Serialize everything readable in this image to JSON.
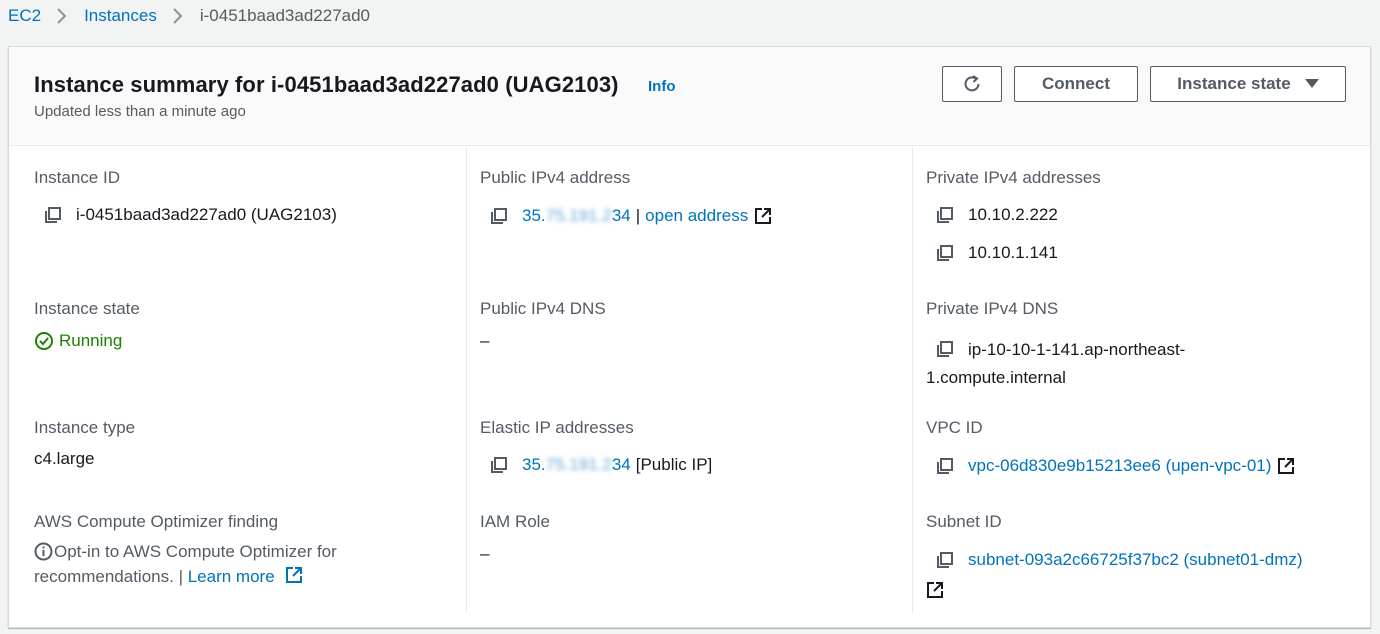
{
  "breadcrumb": {
    "items": [
      "EC2",
      "Instances"
    ],
    "current": "i-0451baad3ad227ad0"
  },
  "header": {
    "title": "Instance summary for i-0451baad3ad227ad0 (UAG2103)",
    "info": "Info",
    "subtitle": "Updated less than a minute ago",
    "connect_label": "Connect",
    "instance_state_label": "Instance state"
  },
  "details": {
    "instance_id": {
      "label": "Instance ID",
      "value": "i-0451baad3ad227ad0 (UAG2103)"
    },
    "public_ipv4": {
      "label": "Public IPv4 address",
      "ip_prefix": "35.",
      "ip_masked": "75.191.2",
      "ip_suffix": "34",
      "separator": "|",
      "open_link": "open address"
    },
    "private_ipv4": {
      "label": "Private IPv4 addresses",
      "values": [
        "10.10.2.222",
        "10.10.1.141"
      ]
    },
    "instance_state": {
      "label": "Instance state",
      "value": "Running"
    },
    "public_dns": {
      "label": "Public IPv4 DNS",
      "value": "–"
    },
    "private_dns": {
      "label": "Private IPv4 DNS",
      "line1": "ip-10-10-1-141.ap-northeast-",
      "line2": "1.compute.internal"
    },
    "instance_type": {
      "label": "Instance type",
      "value": "c4.large"
    },
    "elastic_ip": {
      "label": "Elastic IP addresses",
      "ip_prefix": "35.",
      "ip_masked": "75.191.2",
      "ip_suffix": "34",
      "tag": "[Public IP]"
    },
    "vpc_id": {
      "label": "VPC ID",
      "value": "vpc-06d830e9b15213ee6 (upen-vpc-01)"
    },
    "optimizer": {
      "label": "AWS Compute Optimizer finding",
      "text1": "Opt-in to AWS Compute Optimizer for",
      "text2": "recommendations. |",
      "learn_more": "Learn more"
    },
    "iam_role": {
      "label": "IAM Role",
      "value": "–"
    },
    "subnet_id": {
      "label": "Subnet ID",
      "value": "subnet-093a2c66725f37bc2 (subnet01-dmz)"
    }
  },
  "colors": {
    "link": "#0073bb",
    "running": "#1d8102",
    "label": "#545b64",
    "text": "#16191f"
  },
  "icons": [
    "chevron-right-icon",
    "refresh-icon",
    "caret-down-icon",
    "copy-icon",
    "external-link-icon",
    "check-circle-icon",
    "info-circle-icon"
  ]
}
